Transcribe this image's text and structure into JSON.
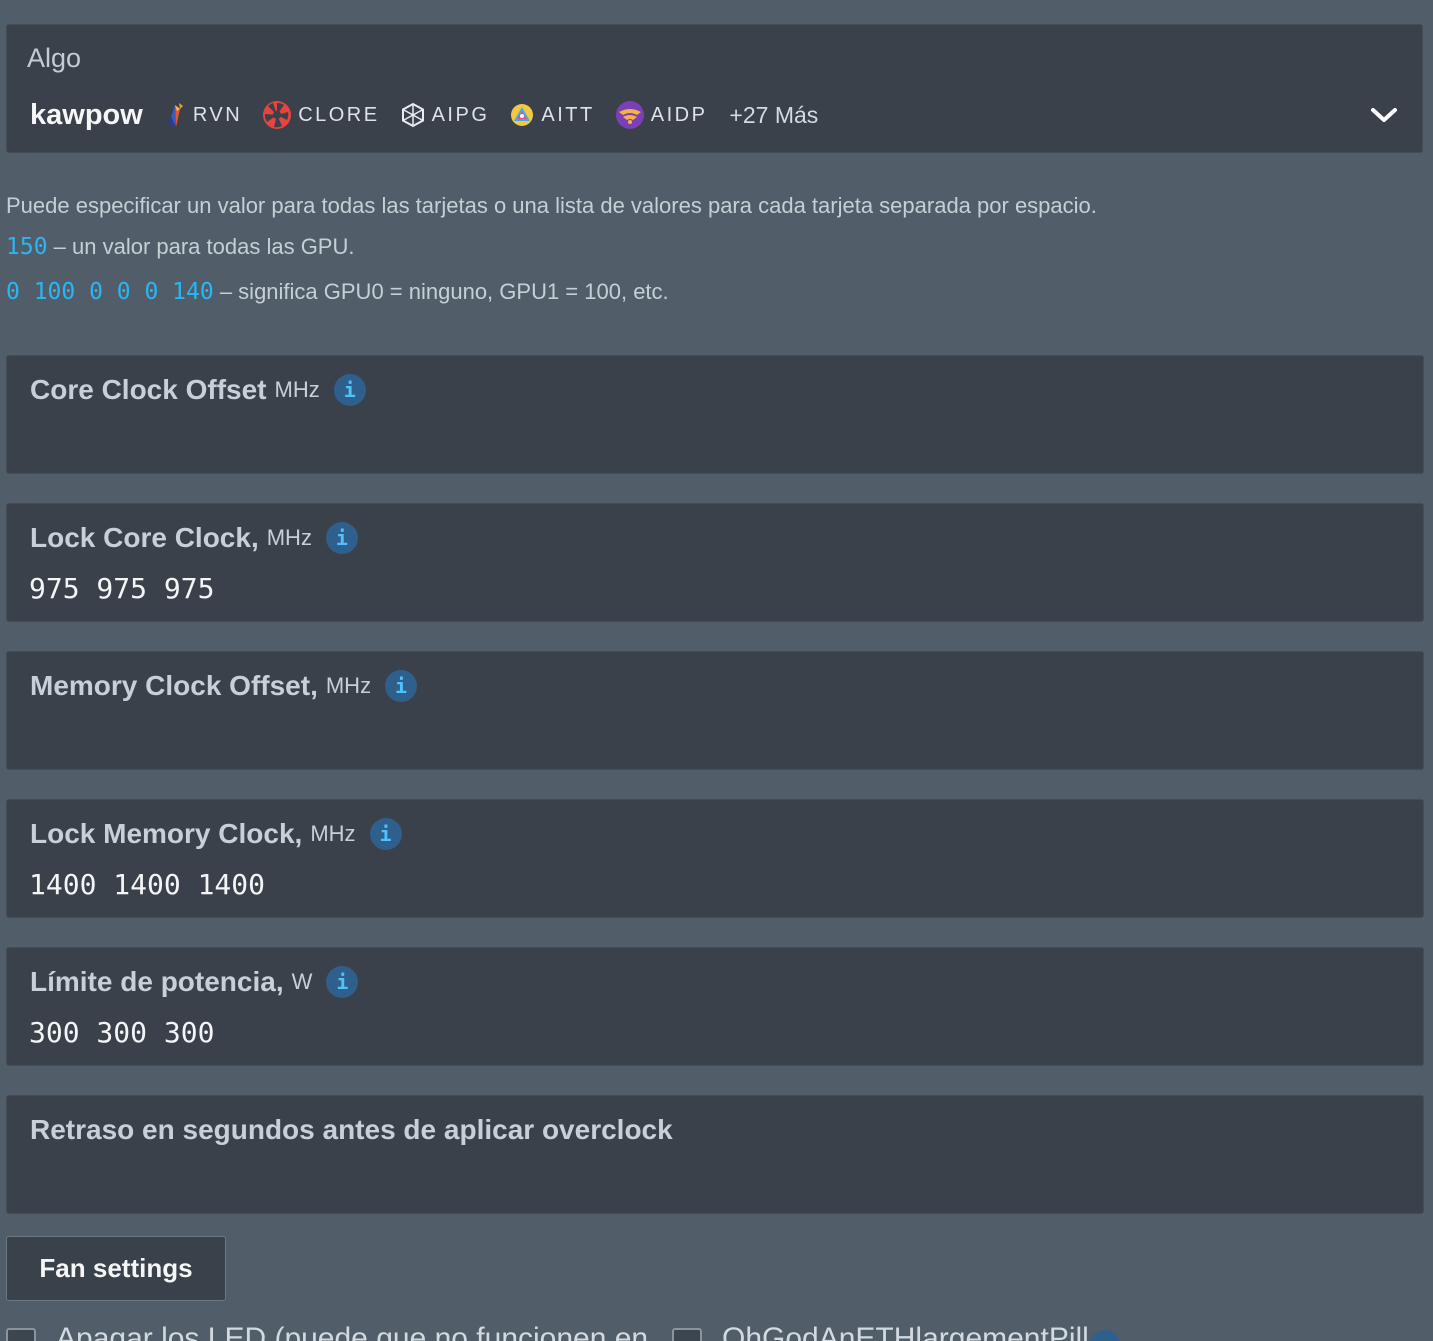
{
  "algo": {
    "label": "Algo",
    "name": "kawpow",
    "coins": [
      {
        "ticker": "RVN",
        "icon": "raven-coin-icon"
      },
      {
        "ticker": "CLORE",
        "icon": "clore-coin-icon"
      },
      {
        "ticker": "AIPG",
        "icon": "aipg-coin-icon"
      },
      {
        "ticker": "AITT",
        "icon": "aitt-coin-icon"
      },
      {
        "ticker": "AIDP",
        "icon": "aidp-coin-icon"
      }
    ],
    "more": "+27 Más"
  },
  "help": {
    "intro": "Puede especificar un valor para todas las tarjetas o una lista de valores para cada tarjeta separada por espacio.",
    "example1_code": "150",
    "example1_text": " – un valor para todas las GPU.",
    "example2_code": "0 100 0 0 0 140",
    "example2_text": " – significa GPU0 = ninguno, GPU1 = 100, etc."
  },
  "fields": [
    {
      "label": "Core Clock Offset",
      "unit": "MHz",
      "value": "",
      "info": "i"
    },
    {
      "label": "Lock Core Clock,",
      "unit": "MHz",
      "value": "975 975 975",
      "info": "i"
    },
    {
      "label": "Memory Clock Offset,",
      "unit": "MHz",
      "value": "",
      "info": "i"
    },
    {
      "label": "Lock Memory Clock,",
      "unit": "MHz",
      "value": "1400 1400 1400",
      "info": "i"
    },
    {
      "label": "Límite de potencia,",
      "unit": "W",
      "value": "300 300 300",
      "info": "i"
    },
    {
      "label": "Retraso en segundos antes de aplicar overclock",
      "unit": "",
      "value": ""
    }
  ],
  "fan_settings_label": "Fan settings",
  "bottom": {
    "checkbox1_label": "Apagar los LED (puede que no funcionen en",
    "checkbox2_label": "OhGodAnETHlargementPill"
  },
  "colors": {
    "background": "#515d68",
    "card": "#3a414a",
    "accent": "#29b6f6",
    "info_badge": "#2f5f8d"
  }
}
